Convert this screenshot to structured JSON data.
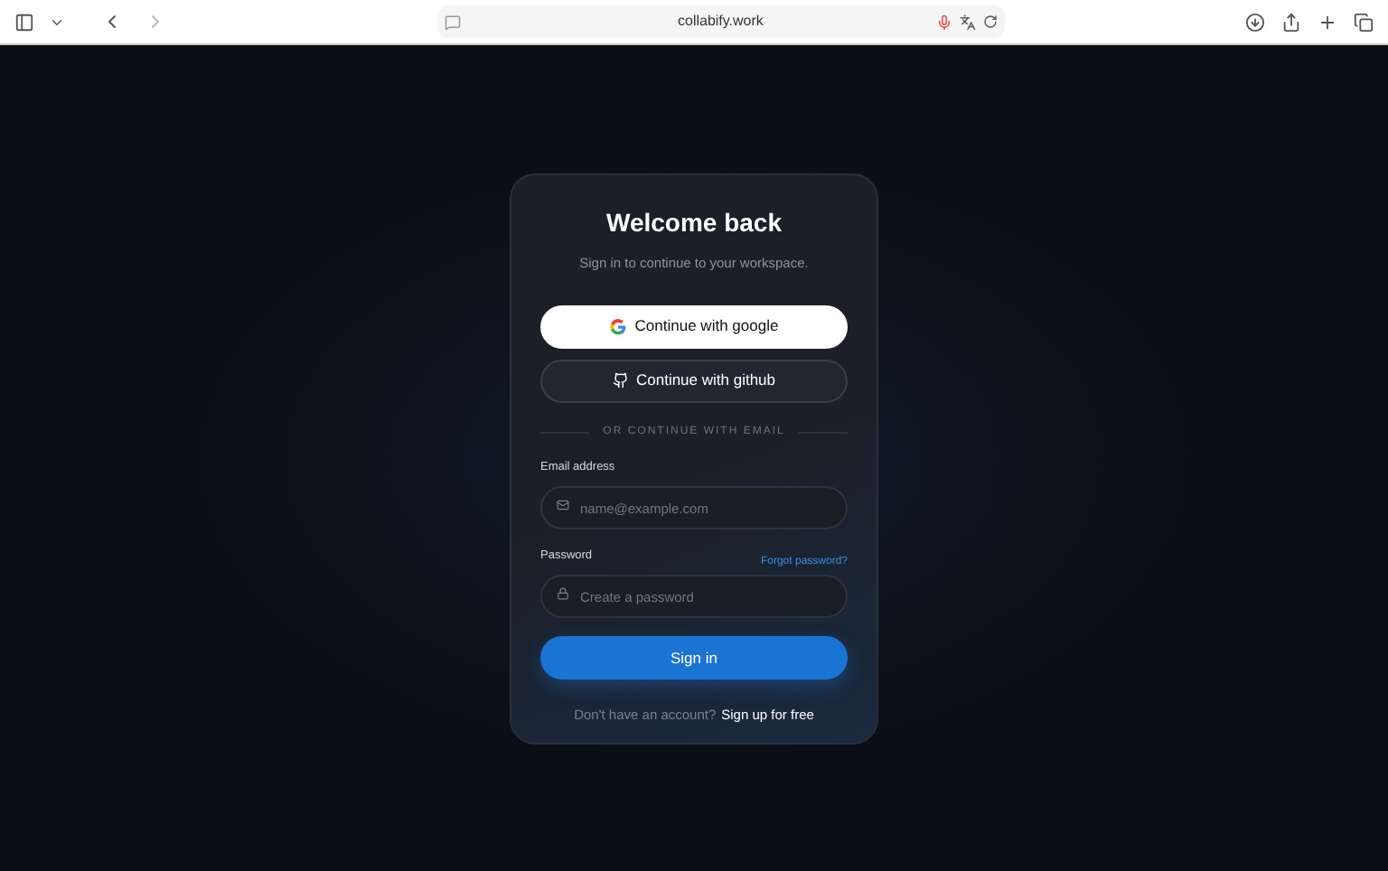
{
  "browser": {
    "url": "collabify.work"
  },
  "card": {
    "title": "Welcome back",
    "subtitle": "Sign in to continue to your workspace.",
    "providers": [
      {
        "kind": "google",
        "label": "Continue with google"
      },
      {
        "kind": "github",
        "label": "Continue with github"
      }
    ],
    "divider": "OR CONTINUE WITH EMAIL",
    "fields": [
      {
        "kind": "email",
        "label": "Email address",
        "placeholder": "name@example.com"
      },
      {
        "kind": "password",
        "label": "Password",
        "placeholder": "Create a password",
        "link": "Forgot password?"
      }
    ],
    "submit": "Sign in",
    "footer": {
      "text": "Don't have an account?",
      "link": "Sign up for free"
    }
  }
}
